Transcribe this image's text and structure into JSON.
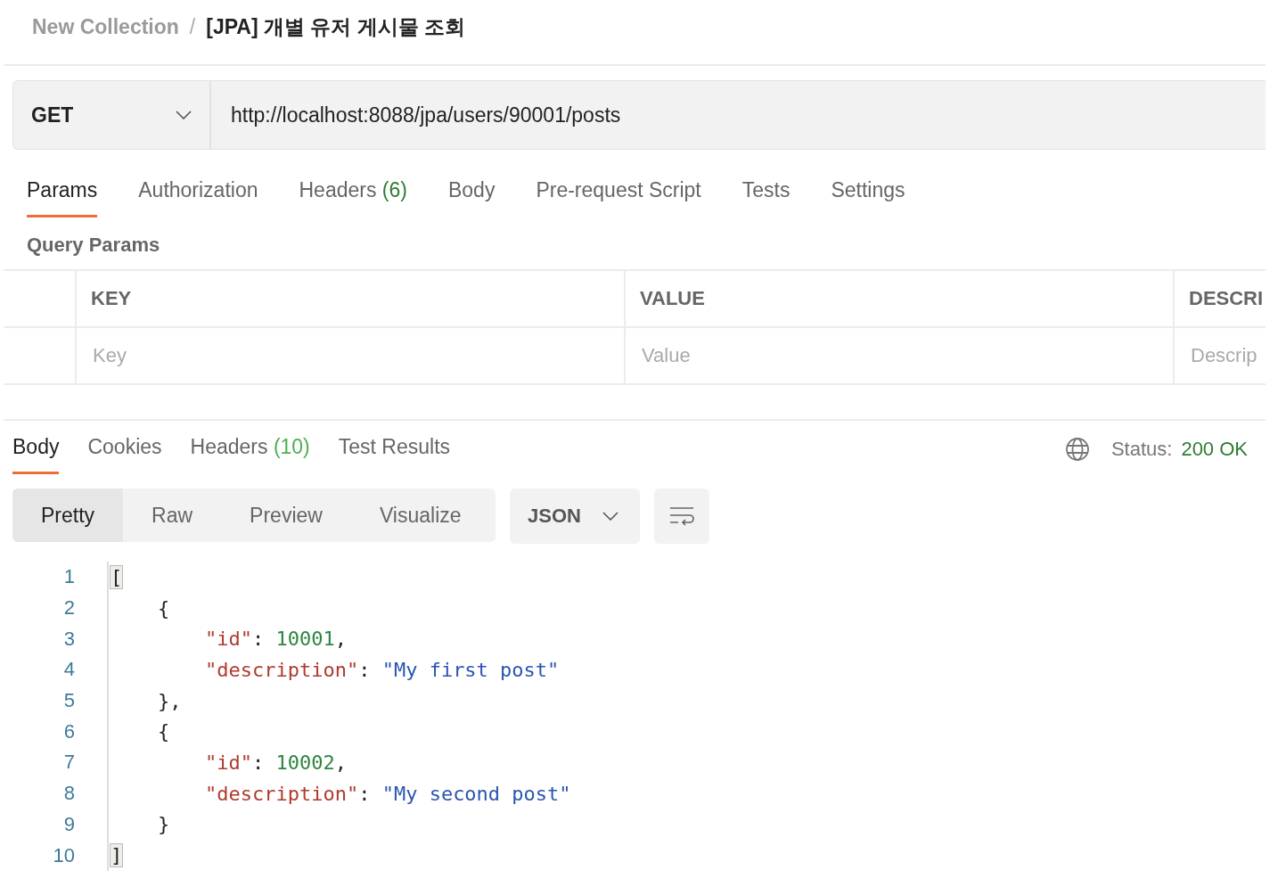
{
  "breadcrumb": {
    "collection": "New Collection",
    "separator": "/",
    "request": "[JPA] 개별 유저 게시물 조회"
  },
  "request": {
    "method": "GET",
    "url": "http://localhost:8088/jpa/users/90001/posts"
  },
  "request_tabs": [
    {
      "label": "Params",
      "selected": true
    },
    {
      "label": "Authorization",
      "selected": false
    },
    {
      "label": "Headers",
      "count": "(6)",
      "selected": false
    },
    {
      "label": "Body",
      "selected": false
    },
    {
      "label": "Pre-request Script",
      "selected": false
    },
    {
      "label": "Tests",
      "selected": false
    },
    {
      "label": "Settings",
      "selected": false
    }
  ],
  "query_params": {
    "title": "Query Params",
    "columns": [
      "KEY",
      "VALUE",
      "DESCRI"
    ],
    "placeholders": [
      "Key",
      "Value",
      "Descrip"
    ]
  },
  "response_tabs": [
    {
      "label": "Body",
      "selected": true
    },
    {
      "label": "Cookies",
      "selected": false
    },
    {
      "label": "Headers",
      "count": "(10)",
      "selected": false
    },
    {
      "label": "Test Results",
      "selected": false
    }
  ],
  "status": {
    "label": "Status:",
    "value": "200 OK"
  },
  "view_modes": [
    {
      "label": "Pretty",
      "selected": true
    },
    {
      "label": "Raw",
      "selected": false
    },
    {
      "label": "Preview",
      "selected": false
    },
    {
      "label": "Visualize",
      "selected": false
    }
  ],
  "format": "JSON",
  "code_lines": [
    {
      "number": "1",
      "tokens": [
        {
          "kind": "bracket",
          "text": "["
        }
      ]
    },
    {
      "number": "2",
      "tokens": [
        {
          "kind": "punct",
          "text": "    {"
        }
      ]
    },
    {
      "number": "3",
      "tokens": [
        {
          "kind": "key",
          "text": "        \"id\""
        },
        {
          "kind": "punct",
          "text": ": "
        },
        {
          "kind": "number",
          "text": "10001"
        },
        {
          "kind": "punct",
          "text": ","
        }
      ]
    },
    {
      "number": "4",
      "tokens": [
        {
          "kind": "key",
          "text": "        \"description\""
        },
        {
          "kind": "punct",
          "text": ": "
        },
        {
          "kind": "string",
          "text": "\"My first post\""
        }
      ]
    },
    {
      "number": "5",
      "tokens": [
        {
          "kind": "punct",
          "text": "    },"
        }
      ]
    },
    {
      "number": "6",
      "tokens": [
        {
          "kind": "punct",
          "text": "    {"
        }
      ]
    },
    {
      "number": "7",
      "tokens": [
        {
          "kind": "key",
          "text": "        \"id\""
        },
        {
          "kind": "punct",
          "text": ": "
        },
        {
          "kind": "number",
          "text": "10002"
        },
        {
          "kind": "punct",
          "text": ","
        }
      ]
    },
    {
      "number": "8",
      "tokens": [
        {
          "kind": "key",
          "text": "        \"description\""
        },
        {
          "kind": "punct",
          "text": ": "
        },
        {
          "kind": "string",
          "text": "\"My second post\""
        }
      ]
    },
    {
      "number": "9",
      "tokens": [
        {
          "kind": "punct",
          "text": "    }"
        }
      ]
    },
    {
      "number": "10",
      "tokens": [
        {
          "kind": "bracket",
          "text": "]"
        }
      ]
    }
  ]
}
